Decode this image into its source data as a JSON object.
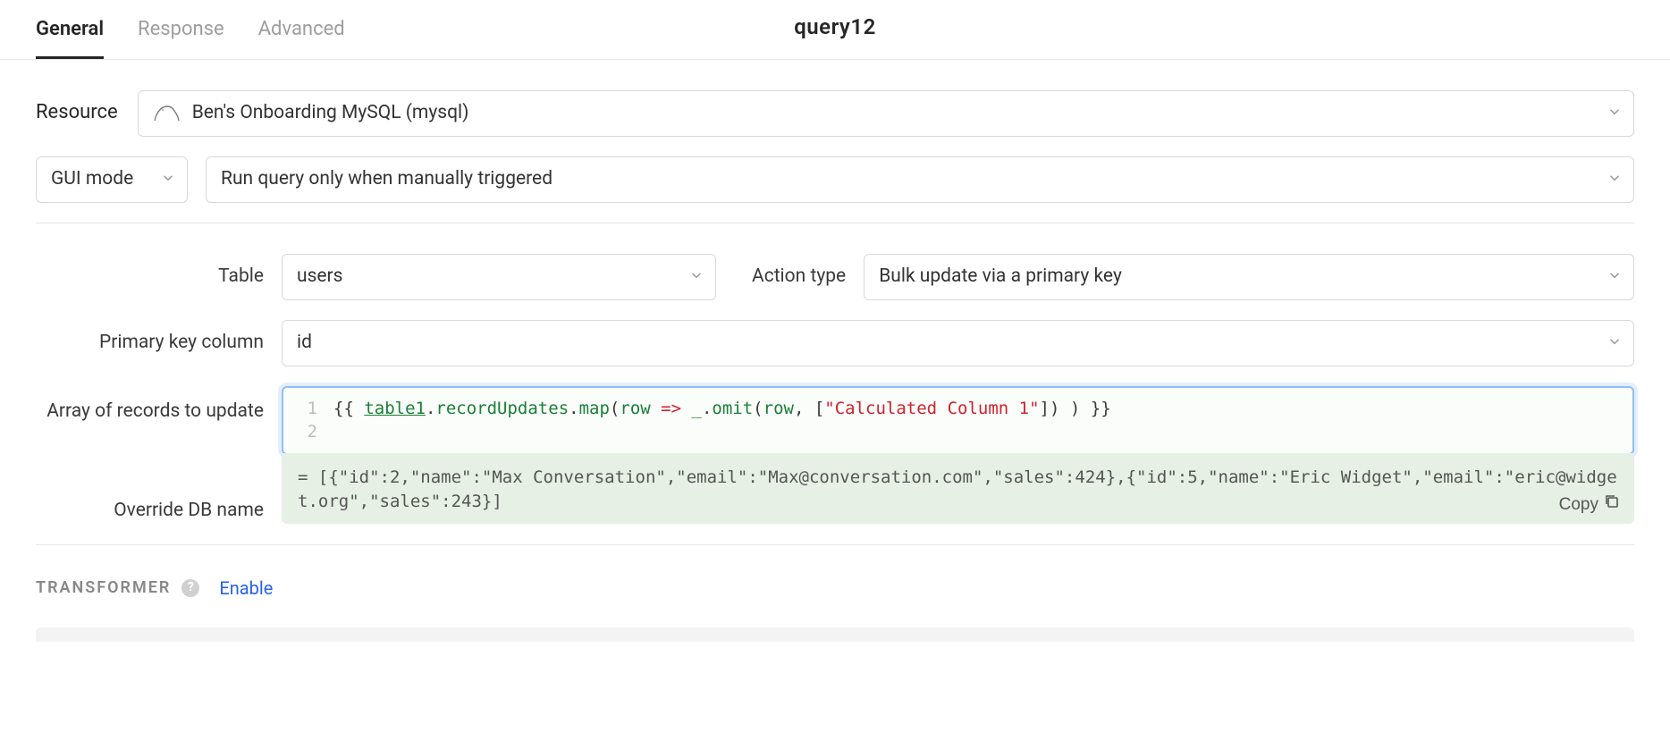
{
  "header": {
    "tabs": {
      "general": "General",
      "response": "Response",
      "advanced": "Advanced"
    },
    "active_tab": "general",
    "query_name": "query12"
  },
  "resource": {
    "label": "Resource",
    "value": "Ben's Onboarding MySQL (mysql)",
    "icon": "mysql-dolphin-icon"
  },
  "mode_row": {
    "mode_value": "GUI mode",
    "trigger_value": "Run query only when manually triggered"
  },
  "table_row": {
    "table_label": "Table",
    "table_value": "users",
    "action_label": "Action type",
    "action_value": "Bulk update via a primary key"
  },
  "pk_row": {
    "label": "Primary key column",
    "value": "id"
  },
  "records": {
    "records_label": "Array of records to update",
    "override_label": "Override DB name",
    "code_line_1": "1",
    "code_line_2": "2",
    "code": {
      "open": "{{ ",
      "var": "table1",
      "dot1": ".",
      "prop1": "recordUpdates",
      "dot2": ".",
      "fn": "map",
      "p1": "(",
      "arg": "row",
      "sp1": " ",
      "arrow": "=>",
      "sp2": " ",
      "under": "_",
      "dot3": ".",
      "omit": "omit",
      "p2": "(",
      "arg2": "row",
      "comma": ", ",
      "lb": "[",
      "str": "\"Calculated Column 1\"",
      "rb": "]",
      "p3": ")",
      "sp3": " ",
      "p4": ")",
      "close": " }}"
    },
    "result_prefix": "= ",
    "result": "[{\"id\":2,\"name\":\"Max Conversation\",\"email\":\"Max@conversation.com\",\"sales\":424},{\"id\":5,\"name\":\"Eric Widget\",\"email\":\"eric@widget.org\",\"sales\":243}]",
    "copy_label": "Copy"
  },
  "transformer": {
    "heading": "TRANSFORMER",
    "help": "?",
    "enable": "Enable"
  }
}
